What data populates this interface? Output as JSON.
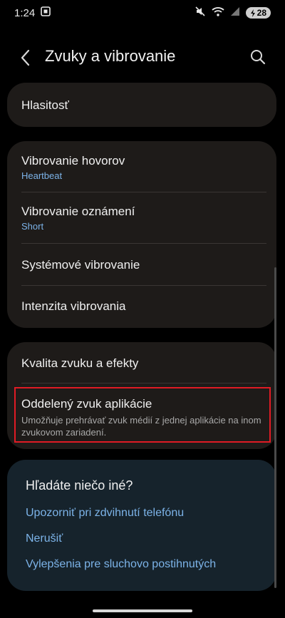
{
  "status_bar": {
    "time": "1:24",
    "battery": "28",
    "icons": [
      "screenshot-icon",
      "mute-icon",
      "wifi-icon",
      "signal-icon",
      "battery-charging-icon"
    ]
  },
  "header": {
    "title": "Zvuky a vibrovanie",
    "back_icon": "chevron-left-icon",
    "search_icon": "search-icon"
  },
  "items": {
    "volume": {
      "title": "Hlasitosť"
    },
    "call_vibration": {
      "title": "Vibrovanie hovorov",
      "value": "Heartbeat"
    },
    "notification_vibration": {
      "title": "Vibrovanie oznámení",
      "value": "Short"
    },
    "system_vibration": {
      "title": "Systémové vibrovanie"
    },
    "vibration_intensity": {
      "title": "Intenzita vibrovania"
    },
    "sound_quality": {
      "title": "Kvalita zvuku a efekty"
    },
    "separate_app_sound": {
      "title": "Oddelený zvuk aplikácie",
      "description": "Umožňuje prehrávať zvuk médií z jednej aplikácie na inom zvukovom zariadení."
    }
  },
  "suggestions": {
    "title": "Hľadáte niečo iné?",
    "links": [
      "Upozorniť pri zdvihnutí telefónu",
      "Nerušiť",
      "Vylepšenia pre sluchovo postihnutých"
    ]
  },
  "colors": {
    "background": "#000000",
    "card": "#1e1b19",
    "suggestion_card": "#16232c",
    "accent": "#7cb3e8",
    "highlight": "#e01b24"
  }
}
